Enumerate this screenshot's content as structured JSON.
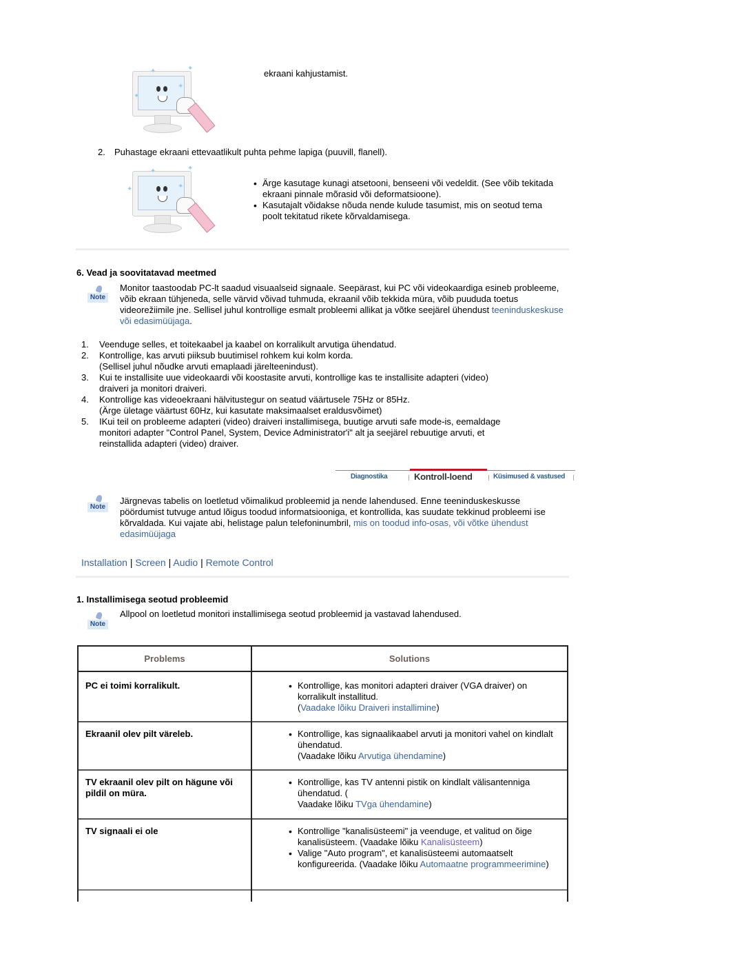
{
  "top_section": {
    "caption_1": "ekraani kahjustamist.",
    "step_2": {
      "number": "2.",
      "text": "Puhastage ekraani ettevaatlikult puhta pehme lapiga (puuvill, flanell)."
    },
    "bullets": [
      "Ärge kasutage kunagi atsetooni, benseeni või vedeldit. (See võib tekitada ekraani pinnale mõrasid või deformatsioone).",
      "Kasutajalt võidakse nõuda nende kulude tasumist, mis on seotud tema poolt tekitatud rikete kõrvaldamisega."
    ],
    "images": [
      "monitor-cleaning-illustration",
      "monitor-cleaning-illustration"
    ]
  },
  "section6": {
    "heading": "6. Vead ja soovitatavad meetmed",
    "note_label": "Note",
    "note_text": "Monitor taastoodab PC-lt saadud visuaalseid signaale. Seepärast, kui PC või videokaardiga esineb probleeme, võib ekraan tühjeneda, selle värvid võivad tuhmuda, ekraanil võib tekkida müra, võib puududa toetus videorežiimile jne. Sellisel juhul kontrollige esmalt probleemi allikat ja võtke seejärel ühendust ",
    "note_link": "teeninduskeskuse või edasimüüjaga",
    "note_end": ".",
    "steps": [
      {
        "n": "1.",
        "lines": [
          "Veenduge selles, et toitekaabel ja kaabel on korralikult arvutiga ühendatud."
        ]
      },
      {
        "n": "2.",
        "lines": [
          "Kontrollige, kas arvuti piiksub buutimisel rohkem kui kolm korda.",
          "(Sellisel juhul nõudke arvuti emaplaadi järelteenindust)."
        ]
      },
      {
        "n": "3.",
        "lines": [
          "Kui te installisite uue videokaardi või koostasite arvuti, kontrollige kas te installisite adapteri (video)",
          "draiveri ja monitori draiveri."
        ]
      },
      {
        "n": "4.",
        "lines": [
          "Kontrollige kas videoekraani hälvitustegur on seatud väärtusele 75Hz or 85Hz.",
          "(Ärge ületage väärtust 60Hz, kui kasutate maksimaalset eraldusvõimet)"
        ]
      },
      {
        "n": "5.",
        "lines": [
          "IKui teil on probleeme adapteri (video) draiveri installimisega, buutige arvuti safe mode-is, eemaldage",
          "monitori adapter \"Control Panel, System, Device Administrator'i\" alt ja seejärel rebuutige arvuti, et",
          "reinstallida adapteri (video) draiver."
        ]
      }
    ]
  },
  "tabs": {
    "items": [
      {
        "label": "Diagnostika",
        "active": false
      },
      {
        "label": "Kontroll-loend",
        "active": true
      },
      {
        "label": "Küsimused & vastused",
        "active": false
      }
    ],
    "active_color": "#c0182a"
  },
  "intro_note": {
    "label": "Note",
    "text": "Järgnevas tabelis on loetletud võimalikud probleemid ja nende lahendused. Enne teeninduskeskusse pöördumist tutvuge antud lõigus toodud informatsiooniga, et kontrollida, kas suudate tekkinud probleemi ise kõrvaldada. Kui vajate abi, helistage palun telefoninumbril, ",
    "link": "mis on toodud info-osas, või võtke ühendust edasimüüjaga"
  },
  "nav_links": {
    "items": [
      "Installation",
      "Screen",
      "Audio",
      "Remote Control"
    ],
    "separator": "|"
  },
  "section1": {
    "heading": "1. Installimisega seotud probleemid",
    "note_label": "Note",
    "note_text": "Allpool on loetletud monitori installimisega seotud probleemid ja vastavad lahendused."
  },
  "table": {
    "headers": {
      "problems": "Problems",
      "solutions": "Solutions"
    },
    "rows": [
      {
        "problem": "PC ei toimi korralikult.",
        "solutions": [
          {
            "text": "Kontrollige, kas monitori adapteri draiver (VGA draiver) on korralikult installitud.",
            "pre": "(Vaadake lõiku ",
            "link": "Draiveri installimine",
            "post": ")",
            "link_in_pre": true
          }
        ]
      },
      {
        "problem": "Ekraanil olev pilt väreleb.",
        "solutions": [
          {
            "text": "Kontrollige, kas signaalikaabel arvuti ja monitori vahel on kindlalt ühendatud.",
            "pre": "(Vaadake lõiku ",
            "link": "Arvutiga ühendamine",
            "post": ")"
          }
        ]
      },
      {
        "problem": "TV ekraanil olev pilt on hägune või pildil on müra.",
        "solutions": [
          {
            "text": "Kontrollige, kas TV antenni pistik on kindlalt välisantenniga ühendatud. (",
            "pre": "Vaadake lõiku ",
            "link": "TVga ühendamine",
            "post": ")"
          }
        ]
      },
      {
        "problem": "TV signaali ei ole",
        "solutions": [
          {
            "text": "Kontrollige \"kanalisüsteemi\" ja veenduge, et valitud on õige kanalisüsteem. (Vaadake lõiku ",
            "link": "Kanalisüsteem",
            "post": ")"
          },
          {
            "text": "Valige \"Auto program\", et kanalisüsteemi automaatselt konfigureerida. (Vaadake lõiku ",
            "link": "Automaatne programmeerimine",
            "post": ")"
          }
        ]
      }
    ]
  },
  "colors": {
    "link": "#3c64a0",
    "link_visited": "#6b5bc4",
    "header_text": "#6b5f58"
  }
}
